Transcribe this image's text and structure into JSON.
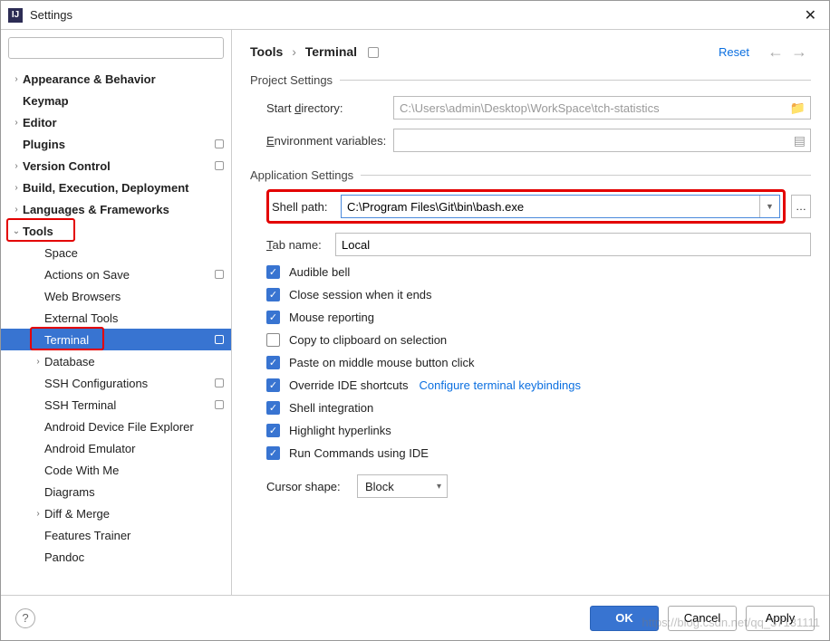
{
  "window": {
    "title": "Settings"
  },
  "search": {
    "placeholder": ""
  },
  "sidebar": {
    "items": [
      {
        "label": "Appearance & Behavior",
        "level": 0,
        "bold": true,
        "arrow": "›",
        "badge": false
      },
      {
        "label": "Keymap",
        "level": 0,
        "bold": true,
        "arrow": "",
        "badge": false
      },
      {
        "label": "Editor",
        "level": 0,
        "bold": true,
        "arrow": "›",
        "badge": false
      },
      {
        "label": "Plugins",
        "level": 0,
        "bold": true,
        "arrow": "",
        "badge": true
      },
      {
        "label": "Version Control",
        "level": 0,
        "bold": true,
        "arrow": "›",
        "badge": true
      },
      {
        "label": "Build, Execution, Deployment",
        "level": 0,
        "bold": true,
        "arrow": "›",
        "badge": false
      },
      {
        "label": "Languages & Frameworks",
        "level": 0,
        "bold": true,
        "arrow": "›",
        "badge": false
      },
      {
        "label": "Tools",
        "level": 0,
        "bold": true,
        "arrow": "⌄",
        "badge": false,
        "redbox": true
      },
      {
        "label": "Space",
        "level": 1,
        "bold": false,
        "arrow": "",
        "badge": false
      },
      {
        "label": "Actions on Save",
        "level": 1,
        "bold": false,
        "arrow": "",
        "badge": true
      },
      {
        "label": "Web Browsers",
        "level": 1,
        "bold": false,
        "arrow": "",
        "badge": false
      },
      {
        "label": "External Tools",
        "level": 1,
        "bold": false,
        "arrow": "",
        "badge": false
      },
      {
        "label": "Terminal",
        "level": 1,
        "bold": false,
        "arrow": "",
        "badge": true,
        "selected": true,
        "redbox": true
      },
      {
        "label": "Database",
        "level": 1,
        "bold": false,
        "arrow": "›",
        "badge": false
      },
      {
        "label": "SSH Configurations",
        "level": 1,
        "bold": false,
        "arrow": "",
        "badge": true
      },
      {
        "label": "SSH Terminal",
        "level": 1,
        "bold": false,
        "arrow": "",
        "badge": true
      },
      {
        "label": "Android Device File Explorer",
        "level": 1,
        "bold": false,
        "arrow": "",
        "badge": false
      },
      {
        "label": "Android Emulator",
        "level": 1,
        "bold": false,
        "arrow": "",
        "badge": false
      },
      {
        "label": "Code With Me",
        "level": 1,
        "bold": false,
        "arrow": "",
        "badge": false
      },
      {
        "label": "Diagrams",
        "level": 1,
        "bold": false,
        "arrow": "",
        "badge": false
      },
      {
        "label": "Diff & Merge",
        "level": 1,
        "bold": false,
        "arrow": "›",
        "badge": false
      },
      {
        "label": "Features Trainer",
        "level": 1,
        "bold": false,
        "arrow": "",
        "badge": false
      },
      {
        "label": "Pandoc",
        "level": 1,
        "bold": false,
        "arrow": "",
        "badge": false
      }
    ]
  },
  "breadcrumb": {
    "root": "Tools",
    "leaf": "Terminal",
    "reset": "Reset"
  },
  "project": {
    "legend": "Project Settings",
    "start_dir_label": "Start directory:",
    "start_dir_value": "C:\\Users\\admin\\Desktop\\WorkSpace\\tch-statistics",
    "env_label": "Environment variables:"
  },
  "app": {
    "legend": "Application Settings",
    "shell_label": "Shell path:",
    "shell_value": "C:\\Program Files\\Git\\bin\\bash.exe",
    "tab_label": "Tab name:",
    "tab_value": "Local",
    "checks": [
      {
        "label": "Audible bell",
        "checked": true
      },
      {
        "label": "Close session when it ends",
        "checked": true
      },
      {
        "label": "Mouse reporting",
        "checked": true
      },
      {
        "label": "Copy to clipboard on selection",
        "checked": false
      },
      {
        "label": "Paste on middle mouse button click",
        "checked": true
      },
      {
        "label": "Override IDE shortcuts",
        "checked": true,
        "link": "Configure terminal keybindings"
      },
      {
        "label": "Shell integration",
        "checked": true
      },
      {
        "label": "Highlight hyperlinks",
        "checked": true
      },
      {
        "label": "Run Commands using IDE",
        "checked": true
      }
    ],
    "cursor_label": "Cursor shape:",
    "cursor_value": "Block"
  },
  "footer": {
    "ok": "OK",
    "cancel": "Cancel",
    "apply": "Apply"
  },
  "watermark": "https://blog.csdn.net/qq_37131111"
}
